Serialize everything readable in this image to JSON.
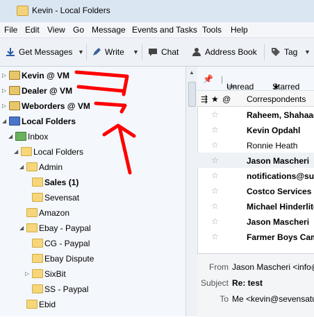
{
  "window": {
    "title": "Kevin - Local Folders"
  },
  "menu": {
    "items": [
      "File",
      "Edit",
      "View",
      "Go",
      "Message",
      "Events and Tasks",
      "Tools",
      "Help"
    ]
  },
  "toolbar": {
    "get_messages": "Get Messages",
    "write": "Write",
    "chat": "Chat",
    "address_book": "Address Book",
    "tag": "Tag"
  },
  "folders": [
    {
      "label": "Kevin @ VM",
      "bold": true,
      "type": "account"
    },
    {
      "label": "Dealer @ VM",
      "bold": true,
      "type": "account"
    },
    {
      "label": "Weborders @ VM",
      "bold": true,
      "type": "account"
    },
    {
      "label": "Local Folders",
      "bold": true,
      "type": "local"
    },
    {
      "label": "Inbox",
      "bold": false,
      "type": "inbox"
    },
    {
      "label": "Local Folders",
      "bold": false,
      "type": "folder"
    },
    {
      "label": "Admin",
      "bold": false,
      "type": "folder"
    },
    {
      "label": "Sales (1)",
      "bold": true,
      "type": "folder"
    },
    {
      "label": "Sevensat",
      "bold": false,
      "type": "folder"
    },
    {
      "label": "Amazon",
      "bold": false,
      "type": "folder"
    },
    {
      "label": "Ebay - Paypal",
      "bold": false,
      "type": "folder"
    },
    {
      "label": "CG - Paypal",
      "bold": false,
      "type": "folder"
    },
    {
      "label": "Ebay Dispute",
      "bold": false,
      "type": "folder"
    },
    {
      "label": "SixBit",
      "bold": false,
      "type": "folder"
    },
    {
      "label": "SS - Paypal",
      "bold": false,
      "type": "folder"
    },
    {
      "label": "Ebid",
      "bold": false,
      "type": "folder"
    }
  ],
  "filter_bar": {
    "unread": "Unread",
    "starred": "Starred"
  },
  "thread_columns": {
    "correspondents": "Correspondents"
  },
  "messages": [
    {
      "correspondent": "Raheem, Shahaad",
      "bold": true
    },
    {
      "correspondent": "Kevin Opdahl",
      "bold": true
    },
    {
      "correspondent": "Ronnie Heath",
      "bold": false
    },
    {
      "correspondent": "Jason Mascheri",
      "bold": true
    },
    {
      "correspondent": "notifications@sup",
      "bold": true
    },
    {
      "correspondent": "Costco Services",
      "bold": true
    },
    {
      "correspondent": "Michael Hinderlite",
      "bold": true
    },
    {
      "correspondent": "Jason Mascheri",
      "bold": true
    },
    {
      "correspondent": "Farmer Boys Camp",
      "bold": true
    }
  ],
  "preview": {
    "from_label": "From",
    "from_value": "Jason Mascheri <info@",
    "subject_label": "Subject",
    "subject_value": "Re: test",
    "to_label": "To",
    "to_value": "Me <kevin@sevensatu"
  },
  "annotation": {
    "color": "#ff0000"
  }
}
